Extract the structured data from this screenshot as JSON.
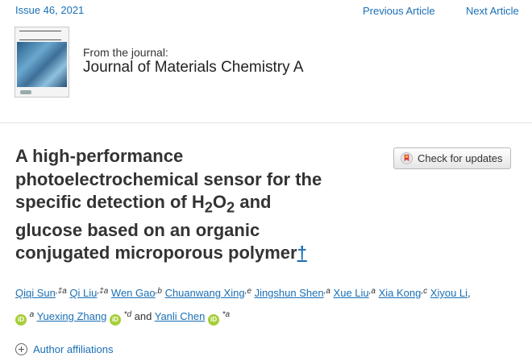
{
  "nav": {
    "issue": "Issue 46, 2021",
    "previous": "Previous Article",
    "next": "Next Article"
  },
  "journal": {
    "from_label": "From the journal:",
    "name": "Journal of Materials Chemistry A",
    "cover_icon": "journal-cover-image"
  },
  "article": {
    "title_l1": "A high-performance",
    "title_l2": "photoelectrochemical sensor for the",
    "title_l3a": "specific detection of H",
    "sub1": "2",
    "O": "O",
    "sub2": "2",
    "title_l3b": " and",
    "title_l4": "glucose based on an organic",
    "title_l5": "conjugated microporous polymer",
    "dagger": "†"
  },
  "check_updates": {
    "label": "Check for updates",
    "icon": "crossmark-icon"
  },
  "authors": [
    {
      "name": "Qiqi Sun",
      "marks": ",‡a"
    },
    {
      "name": "Qi Liu",
      "marks": ",‡a"
    },
    {
      "name": "Wen Gao",
      "marks": ",b"
    },
    {
      "name": "Chuanwang Xing",
      "marks": ",e"
    },
    {
      "name": "Jingshun Shen",
      "marks": ",a"
    },
    {
      "name": "Xue Liu",
      "marks": ",a"
    },
    {
      "name": "Xia Kong",
      "marks": ",c"
    },
    {
      "name": "Xiyou Li",
      "marks": "a"
    },
    {
      "name": "Yuexing Zhang",
      "marks": "*d"
    },
    {
      "name": "Yanli Chen",
      "marks": "*a"
    }
  ],
  "authors_text": {
    "and": "and",
    "comma": ",",
    "orcid": "iD"
  },
  "affiliations": {
    "label": "Author affiliations",
    "icon": "plus-circle-icon"
  },
  "colors": {
    "link": "#1a6fb5",
    "orcid": "#a6ce39",
    "title": "#333333"
  }
}
